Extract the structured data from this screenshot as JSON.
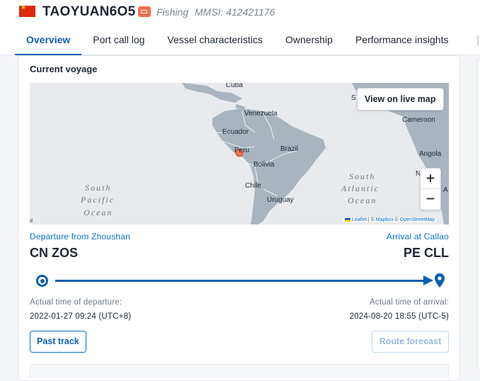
{
  "header": {
    "vessel_name": "TAOYUAN6O5",
    "vessel_type": "Fishing",
    "mmsi": "MMSI: 412421176",
    "flag_icon": "china-flag-icon",
    "colors": {
      "accent": "#0b5fb0",
      "type_badge": "#f26d4f",
      "flag": "#de2910"
    }
  },
  "tabs": [
    {
      "label": "Overview",
      "active": true
    },
    {
      "label": "Port call log",
      "active": false
    },
    {
      "label": "Vessel characteristics",
      "active": false
    },
    {
      "label": "Ownership",
      "active": false
    },
    {
      "label": "Performance insights",
      "active": false
    }
  ],
  "voyage": {
    "title": "Current voyage",
    "map": {
      "live_button": "View on live map",
      "zoom_in": "+",
      "zoom_out": "−",
      "attribution": {
        "leaflet": "Leaflet",
        "sep1": " | © ",
        "mapbox": "Mapbox",
        "sep2": " © ",
        "osm": "OpenStreetMap"
      },
      "corner_label": "d",
      "labels": {
        "cuba": "Cuba",
        "venezuela": "Venezuela",
        "ecuador": "Ecuador",
        "peru": "Peru",
        "brazil": "Brazil",
        "bolivia": "Bolivia",
        "chile": "Chile",
        "uruguay": "Uruguay",
        "cameroon": "Cameroon",
        "angola": "Angola",
        "n_trunc": "N",
        "a_trunc": "A",
        "s_trunc": "S",
        "south_pacific_1": "South",
        "south_pacific_2": "Pacific",
        "south_pacific_3": "Ocean",
        "south_atlantic_1": "South",
        "south_atlantic_2": "Atlantic",
        "south_atlantic_3": "Ocean"
      }
    },
    "departure": {
      "label": "Departure from Zhoushan",
      "code": "CN ZOS",
      "time_label": "Actual time of departure:",
      "time": "2022-01-27 09:24 (UTC+8)"
    },
    "arrival": {
      "label": "Arrival at Callao",
      "code": "PE CLL",
      "time_label": "Actual time of arrival:",
      "time": "2024-08-20 18:55 (UTC-5)"
    },
    "buttons": {
      "past_track": "Past track",
      "route_forecast": "Route forecast"
    }
  }
}
